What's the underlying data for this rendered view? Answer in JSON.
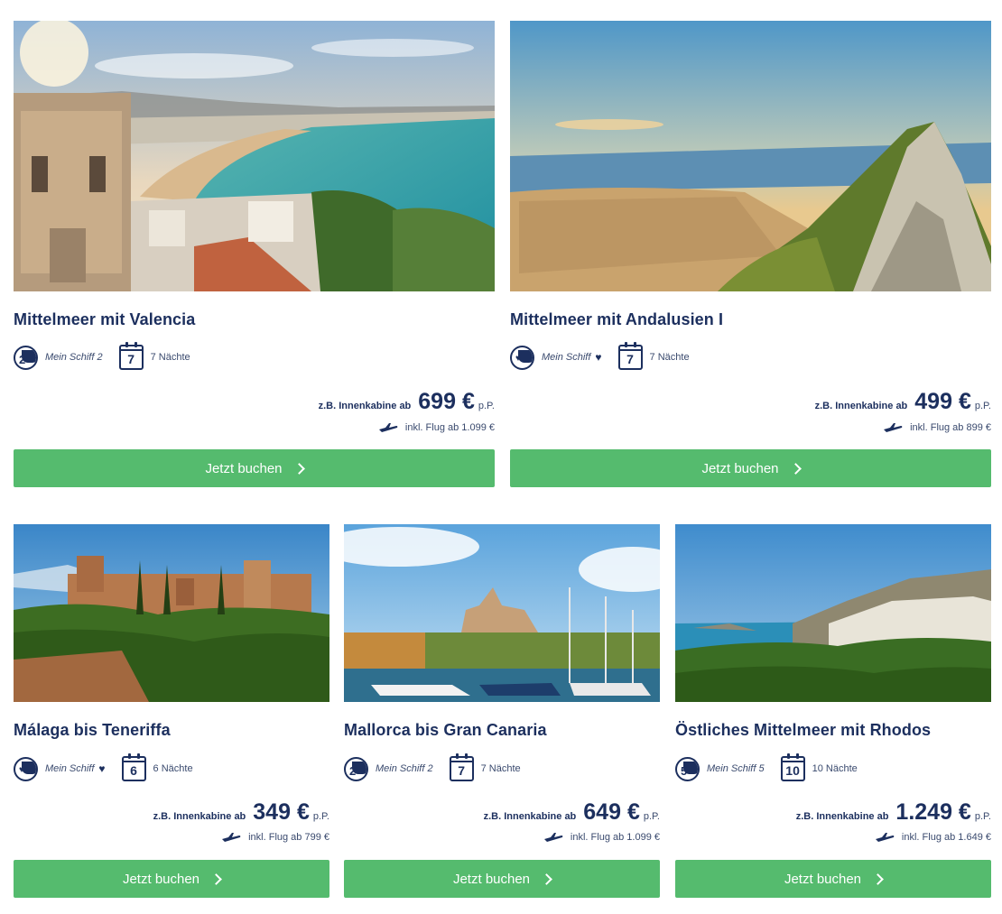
{
  "booking_label": "Jetzt buchen",
  "price_prefix": "z.B. Innenkabine ab",
  "per_person": "p.P.",
  "colors": {
    "accent_green": "#55bb6e",
    "navy": "#1c2f5e"
  },
  "cards": [
    {
      "title": "Mittelmeer mit Valencia",
      "ship": {
        "name": "Mein Schiff 2",
        "number": "2",
        "heart": false,
        "icon": "ship-badge-icon"
      },
      "nights_number": "7",
      "nights_label": "7 Nächte",
      "price": "699 €",
      "flight": "inkl. Flug ab 1.099 €",
      "image": "valencia-coast-photo"
    },
    {
      "title": "Mittelmeer mit Andalusien I",
      "ship": {
        "name": "Mein Schiff",
        "number": "",
        "heart": true,
        "icon": "ship-badge-icon"
      },
      "nights_number": "7",
      "nights_label": "7 Nächte",
      "price": "499 €",
      "flight": "inkl. Flug ab 899 €",
      "image": "gibraltar-rock-photo"
    },
    {
      "title": "Málaga bis Teneriffa",
      "ship": {
        "name": "Mein Schiff",
        "number": "",
        "heart": true,
        "icon": "ship-badge-icon"
      },
      "nights_number": "6",
      "nights_label": "6 Nächte",
      "price": "349 €",
      "flight": "inkl. Flug ab 799 €",
      "image": "alhambra-photo"
    },
    {
      "title": "Mallorca bis Gran Canaria",
      "ship": {
        "name": "Mein Schiff 2",
        "number": "2",
        "heart": false,
        "icon": "ship-badge-icon"
      },
      "nights_number": "7",
      "nights_label": "7 Nächte",
      "price": "649 €",
      "flight": "inkl. Flug ab 1.099 €",
      "image": "palma-harbor-photo"
    },
    {
      "title": "Östliches Mittelmeer mit Rhodos",
      "ship": {
        "name": "Mein Schiff 5",
        "number": "5",
        "heart": false,
        "icon": "ship-badge-icon"
      },
      "nights_number": "10",
      "nights_label": "10 Nächte",
      "price": "1.249 €",
      "flight": "inkl. Flug ab 1.649 €",
      "image": "rhodes-lindos-photo"
    }
  ]
}
